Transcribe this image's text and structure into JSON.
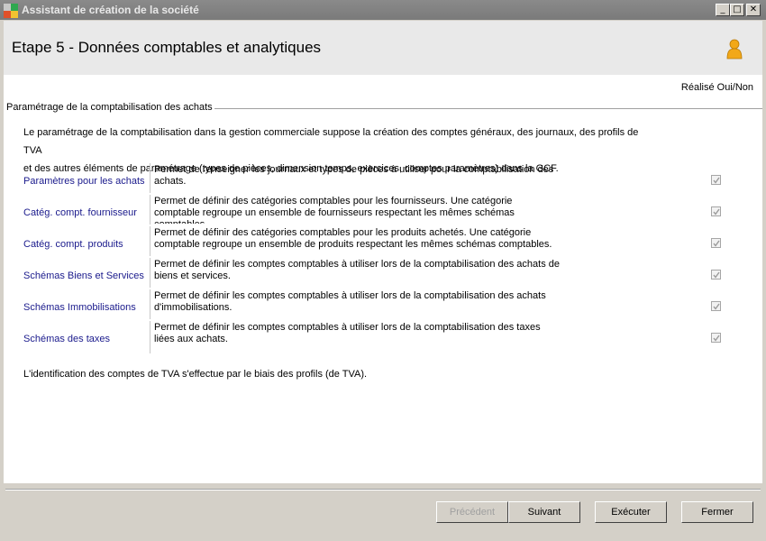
{
  "window": {
    "title": "Assistant de création de la société",
    "minimize_glyph": "_",
    "maximize_glyph": "□",
    "close_glyph": "✕"
  },
  "header": {
    "title": "Etape 5 - Données comptables et analytiques"
  },
  "content": {
    "realise_label": "Réalisé Oui/Non",
    "section_title": "Paramétrage de la comptabilisation des achats",
    "intro_line1": "Le paramétrage de la comptabilisation dans la gestion commerciale suppose la création des comptes généraux, des journaux, des profils de TVA",
    "intro_line2": "et des autres éléments de paramétrage (types de pièces, dimension temps, exercices, comptes paramètres) dans la GCF.",
    "rows": [
      {
        "label": "Paramètres pour les achats",
        "description": "Permet de renseigner les journaux et types de pièces à utiliser pour la comptabilisation des achats.",
        "checked": true
      },
      {
        "label": "Catég. compt. fournisseur",
        "description": "Permet de définir des catégories comptables pour les fournisseurs. Une catégorie comptable regroupe un ensemble de fournisseurs respectant les mêmes schémas comptables.",
        "checked": true
      },
      {
        "label": "Catég. compt. produits",
        "description": "Permet de définir des catégories comptables pour les produits achetés. Une catégorie comptable regroupe un ensemble de produits respectant les mêmes schémas comptables.",
        "checked": true
      },
      {
        "label": "Schémas Biens et Services",
        "description": "Permet de définir les comptes comptables à utiliser lors de la comptabilisation des achats de biens et services.",
        "checked": true
      },
      {
        "label": "Schémas Immobilisations",
        "description": "Permet de définir les comptes comptables à utiliser lors de la comptabilisation des achats d'immobilisations.",
        "checked": true
      },
      {
        "label": "Schémas des taxes",
        "description": "Permet de définir les comptes comptables à utiliser lors de la comptabilisation des taxes liées aux achats.",
        "checked": true
      }
    ],
    "footer_note": "L'identification des comptes de TVA s'effectue par le biais des profils (de TVA)."
  },
  "buttons": {
    "previous": "Précédent",
    "next": "Suivant",
    "execute": "Exécuter",
    "close": "Fermer"
  },
  "colors": {
    "titlebar": "#808080",
    "header_bg": "#e9e9e9",
    "link_text": "#1a1a8c",
    "user_icon": "#f2a818"
  }
}
